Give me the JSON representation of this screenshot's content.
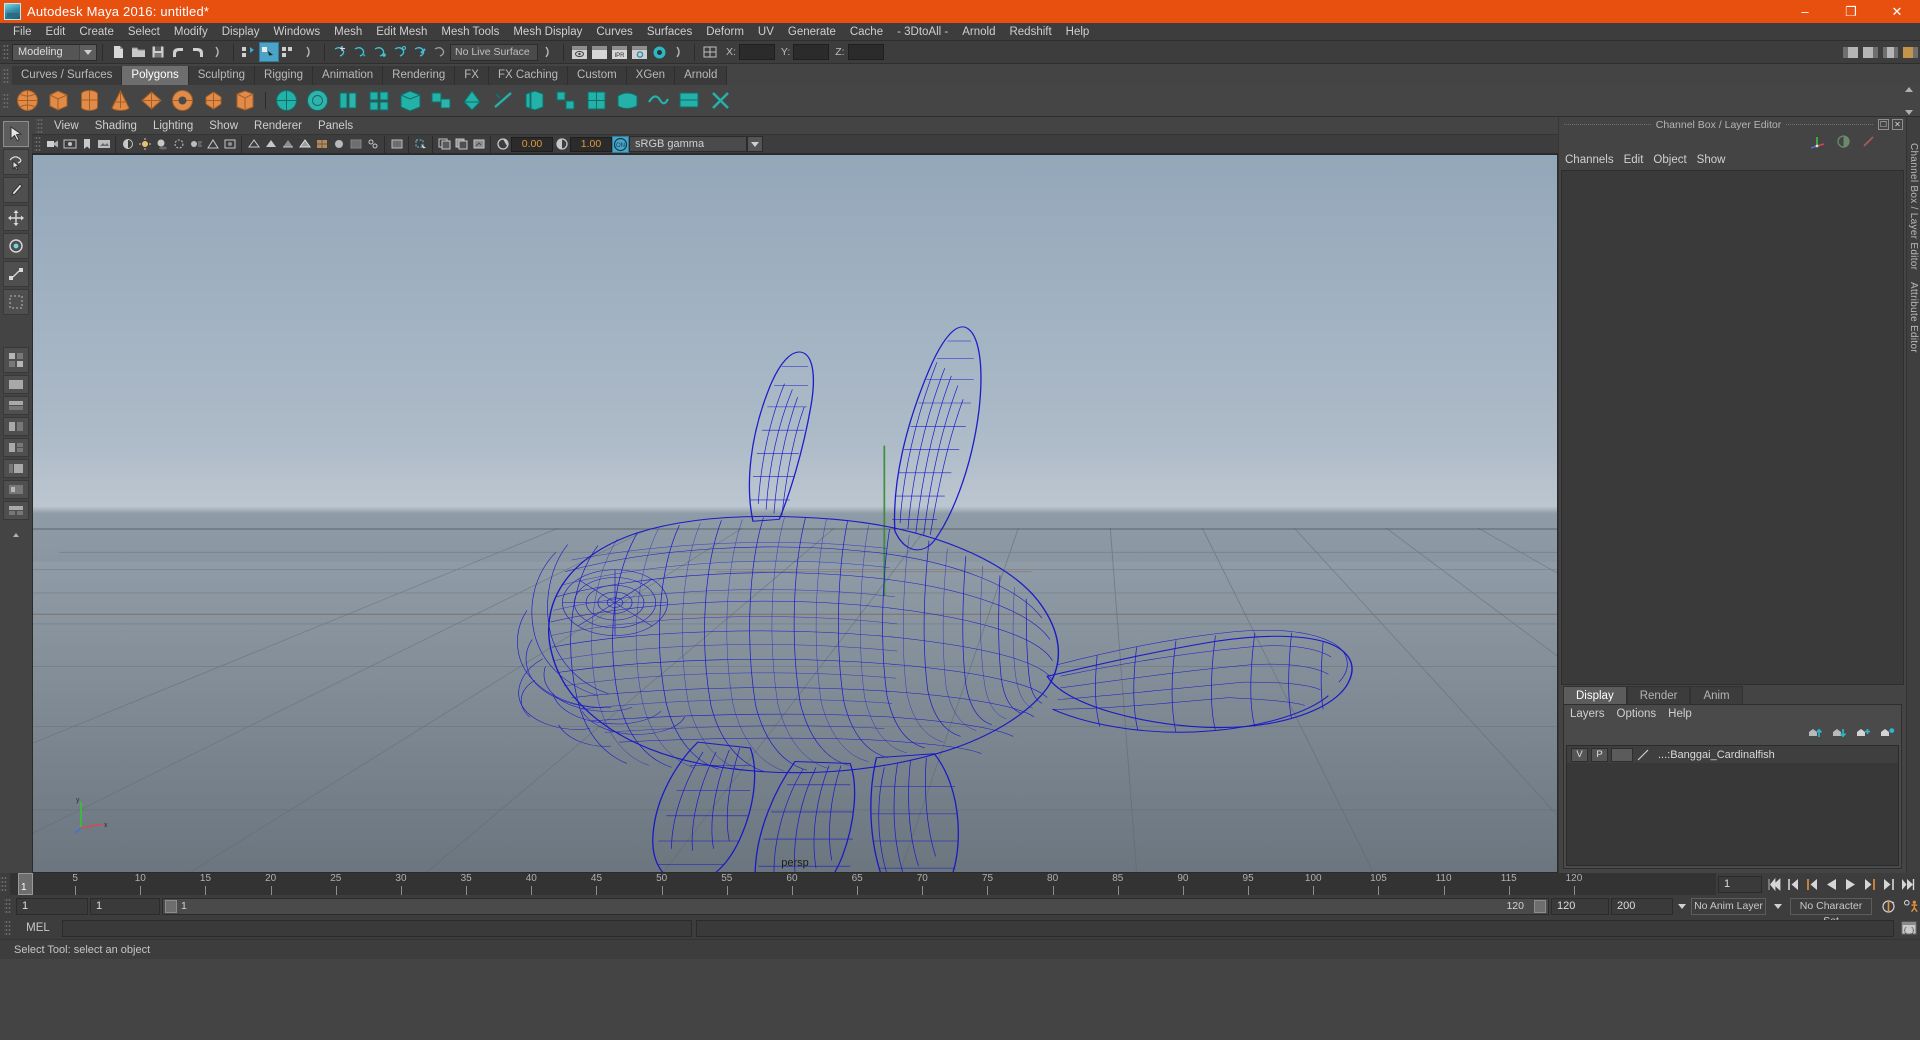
{
  "window": {
    "title": "Autodesk Maya 2016: untitled*",
    "logo": "maya-logo-icon",
    "minimize": "–",
    "maximize": "❐",
    "close": "✕",
    "titlebar_color": "#e8500f"
  },
  "menubar": {
    "items": [
      {
        "label": "File"
      },
      {
        "label": "Edit"
      },
      {
        "label": "Create"
      },
      {
        "label": "Select"
      },
      {
        "label": "Modify"
      },
      {
        "label": "Display"
      },
      {
        "label": "Windows"
      },
      {
        "label": "Mesh"
      },
      {
        "label": "Edit Mesh"
      },
      {
        "label": "Mesh Tools"
      },
      {
        "label": "Mesh Display"
      },
      {
        "label": "Curves"
      },
      {
        "label": "Surfaces"
      },
      {
        "label": "Deform"
      },
      {
        "label": "UV"
      },
      {
        "label": "Generate"
      },
      {
        "label": "Cache"
      },
      {
        "label": "- 3DtoAll -"
      },
      {
        "label": "Arnold"
      },
      {
        "label": "Redshift"
      },
      {
        "label": "Help"
      }
    ]
  },
  "statusbar": {
    "menuset": "Modeling",
    "live_surface": "No Live Surface",
    "coord_labels": [
      "X:",
      "Y:",
      "Z:"
    ],
    "coord_values": [
      "",
      "",
      ""
    ]
  },
  "shelf": {
    "tabs": [
      {
        "label": "Curves / Surfaces",
        "active": false
      },
      {
        "label": "Polygons",
        "active": true
      },
      {
        "label": "Sculpting",
        "active": false
      },
      {
        "label": "Rigging",
        "active": false
      },
      {
        "label": "Animation",
        "active": false
      },
      {
        "label": "Rendering",
        "active": false
      },
      {
        "label": "FX",
        "active": false
      },
      {
        "label": "FX Caching",
        "active": false
      },
      {
        "label": "Custom",
        "active": false
      },
      {
        "label": "XGen",
        "active": false
      },
      {
        "label": "Arnold",
        "active": false
      }
    ],
    "icon_color_primary": "#e08b4a",
    "icon_color_secondary": "#23b1a8"
  },
  "panel_menu": {
    "items": [
      {
        "label": "View"
      },
      {
        "label": "Shading"
      },
      {
        "label": "Lighting"
      },
      {
        "label": "Show"
      },
      {
        "label": "Renderer"
      },
      {
        "label": "Panels"
      }
    ]
  },
  "viewport_toolbar": {
    "exposure_value": "0.00",
    "gamma_value": "1.00",
    "color_management_toggle": "ON",
    "color_profile": "sRGB gamma"
  },
  "viewport": {
    "camera_label": "persp",
    "wireframe_color": "#1414c8",
    "gradient_top": "#93a6b8",
    "gradient_bottom": "#6f7a84",
    "axis_labels": [
      "y",
      "x"
    ]
  },
  "channel_box": {
    "panel_title": "Channel Box / Layer Editor",
    "menus": [
      {
        "label": "Channels"
      },
      {
        "label": "Edit"
      },
      {
        "label": "Object"
      },
      {
        "label": "Show"
      }
    ]
  },
  "layer_editor": {
    "tabs": [
      {
        "label": "Display",
        "active": true
      },
      {
        "label": "Render",
        "active": false
      },
      {
        "label": "Anim",
        "active": false
      }
    ],
    "menus": [
      {
        "label": "Layers"
      },
      {
        "label": "Options"
      },
      {
        "label": "Help"
      }
    ],
    "layers": [
      {
        "visible": "V",
        "playback": "P",
        "name": "...:Banggai_Cardinalfish"
      }
    ]
  },
  "dock_tabs": [
    {
      "label": "Channel Box / Layer Editor"
    },
    {
      "label": "Attribute Editor"
    }
  ],
  "timeline": {
    "current_frame": "1",
    "tick_labels": [
      "5",
      "10",
      "15",
      "20",
      "25",
      "30",
      "35",
      "40",
      "45",
      "50",
      "55",
      "60",
      "65",
      "70",
      "75",
      "80",
      "85",
      "90",
      "95",
      "100",
      "105",
      "110",
      "115",
      "120"
    ],
    "playhead_label": "1",
    "frame_field": "1"
  },
  "range_slider": {
    "start_field": "1",
    "range_start_field": "1",
    "range_bar_start": "1",
    "range_bar_end": "120",
    "range_end_field": "120",
    "playback_end_field": "200",
    "anim_layer": "No Anim Layer",
    "character_set": "No Character Set"
  },
  "playback_controls": {
    "buttons": [
      "go-to-start-icon",
      "step-back-keyframe-icon",
      "step-back-frame-icon",
      "play-backwards-icon",
      "play-forwards-icon",
      "step-forward-frame-icon",
      "step-forward-keyframe-icon",
      "go-to-end-icon"
    ]
  },
  "command_line": {
    "label": "MEL",
    "input_value": "",
    "script_editor_icon": "script-editor-icon"
  },
  "status_line": {
    "message": "Select Tool: select an object"
  },
  "toolbox": {
    "tools": [
      {
        "name": "select-tool",
        "active": true
      },
      {
        "name": "lasso-select-tool",
        "active": false
      },
      {
        "name": "paint-select-tool",
        "active": false
      },
      {
        "name": "move-tool",
        "active": false
      },
      {
        "name": "rotate-tool",
        "active": false
      },
      {
        "name": "scale-tool",
        "active": false
      },
      {
        "name": "last-tool",
        "active": false
      }
    ]
  }
}
